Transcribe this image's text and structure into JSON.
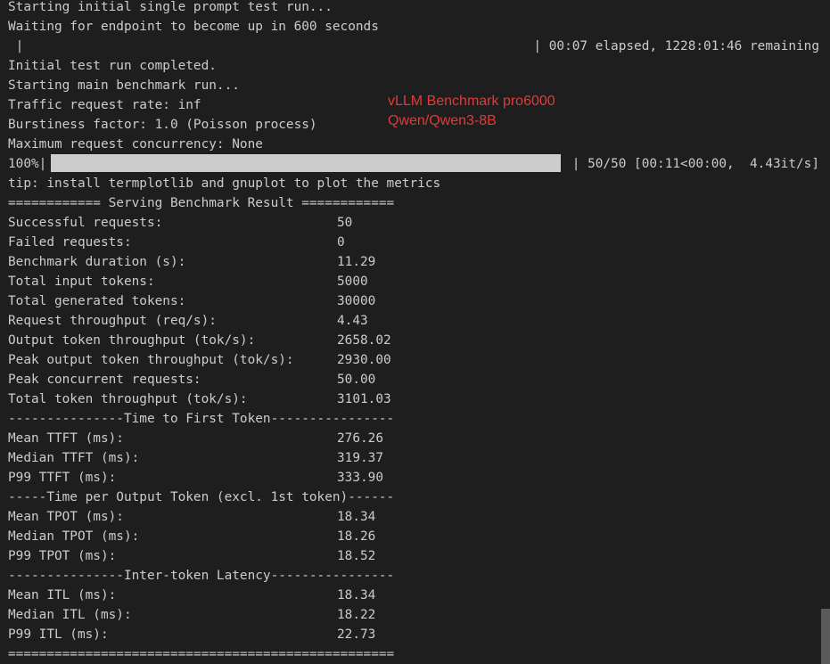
{
  "log": {
    "line1": "Starting initial single prompt test run...",
    "line2": "Waiting for endpoint to become up in 600 seconds",
    "wait_bar_left": " |",
    "wait_bar_right": "| 00:07 elapsed, 1228:01:46 remaining",
    "line4": "Initial test run completed.",
    "line5": "Starting main benchmark run...",
    "line6": "Traffic request rate: inf",
    "line7": "Burstiness factor: 1.0 (Poisson process)",
    "line8": "Maximum request concurrency: None",
    "tip": "tip: install termplotlib and gnuplot to plot the metrics"
  },
  "progress": {
    "percent_label": "100%|",
    "fraction": 1.0,
    "right_text": "| 50/50 [00:11<00:00,  4.43it/s]"
  },
  "annotation": {
    "line1": "vLLM Benchmark pro6000",
    "line2": "Qwen/Qwen3-8B",
    "color": "#e03a3a"
  },
  "result": {
    "header": "============ Serving Benchmark Result ============",
    "metrics": [
      {
        "label": "Successful requests:",
        "value": "50"
      },
      {
        "label": "Failed requests:",
        "value": "0"
      },
      {
        "label": "Benchmark duration (s):",
        "value": "11.29"
      },
      {
        "label": "Total input tokens:",
        "value": "5000"
      },
      {
        "label": "Total generated tokens:",
        "value": "30000"
      },
      {
        "label": "Request throughput (req/s):",
        "value": "4.43"
      },
      {
        "label": "Output token throughput (tok/s):",
        "value": "2658.02"
      },
      {
        "label": "Peak output token throughput (tok/s):",
        "value": "2930.00"
      },
      {
        "label": "Peak concurrent requests:",
        "value": "50.00"
      },
      {
        "label": "Total token throughput (tok/s):",
        "value": "3101.03"
      }
    ],
    "ttft_header": "---------------Time to First Token----------------",
    "ttft": [
      {
        "label": "Mean TTFT (ms):",
        "value": "276.26"
      },
      {
        "label": "Median TTFT (ms):",
        "value": "319.37"
      },
      {
        "label": "P99 TTFT (ms):",
        "value": "333.90"
      }
    ],
    "tpot_header": "-----Time per Output Token (excl. 1st token)------",
    "tpot": [
      {
        "label": "Mean TPOT (ms):",
        "value": "18.34"
      },
      {
        "label": "Median TPOT (ms):",
        "value": "18.26"
      },
      {
        "label": "P99 TPOT (ms):",
        "value": "18.52"
      }
    ],
    "itl_header": "---------------Inter-token Latency----------------",
    "itl": [
      {
        "label": "Mean ITL (ms):",
        "value": "18.34"
      },
      {
        "label": "Median ITL (ms):",
        "value": "18.22"
      },
      {
        "label": "P99 ITL (ms):",
        "value": "22.73"
      }
    ],
    "footer": "=================================================="
  }
}
